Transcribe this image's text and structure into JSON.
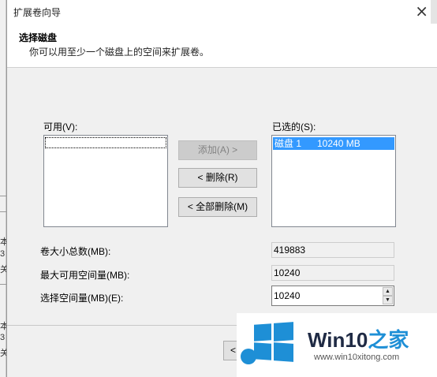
{
  "window": {
    "title": "扩展卷向导",
    "close_glyph": "×"
  },
  "header": {
    "title": "选择磁盘",
    "subtitle": "你可以用至少一个磁盘上的空间来扩展卷。"
  },
  "available": {
    "label": "可用(V):",
    "items": []
  },
  "selected": {
    "label": "已选的(S):",
    "items": [
      {
        "text": "磁盘 1      10240 MB"
      }
    ]
  },
  "buttons": {
    "add": "添加(A) >",
    "remove": "< 删除(R)",
    "remove_all": "< 全部删除(M)",
    "back": "< 上"
  },
  "fields": {
    "total_label": "卷大小总数(MB):",
    "total_value": "419883",
    "max_label": "最大可用空间量(MB):",
    "max_value": "10240",
    "select_label": "选择空间量(MB)(E):",
    "select_value": "10240"
  },
  "watermark": {
    "brand": "Win10",
    "brand_accent": "之家",
    "url": "www.win10xitong.com",
    "colors": {
      "accent": "#1e8fd6",
      "dark": "#1f2a44"
    }
  },
  "background_fragments": {
    "left": [
      "本",
      "3",
      "关",
      "本",
      "3",
      "关"
    ]
  }
}
